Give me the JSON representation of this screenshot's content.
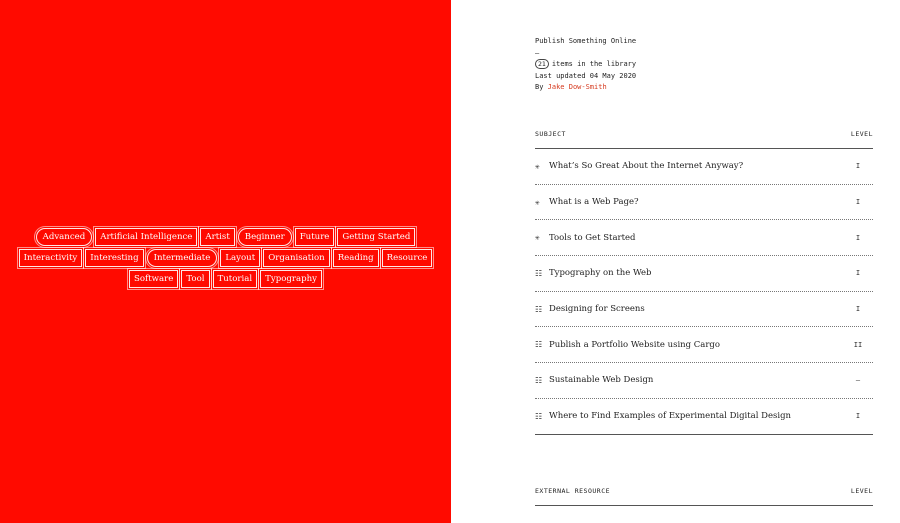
{
  "tags": [
    [
      {
        "label": "Advanced",
        "pill": true
      },
      {
        "label": "Artificial Intelligence",
        "pill": false
      },
      {
        "label": "Artist",
        "pill": false
      },
      {
        "label": "Beginner",
        "pill": true
      },
      {
        "label": "Future",
        "pill": false
      },
      {
        "label": "Getting Started",
        "pill": false
      }
    ],
    [
      {
        "label": "Interactivity",
        "pill": false
      },
      {
        "label": "Interesting",
        "pill": false
      },
      {
        "label": "Intermediate",
        "pill": true
      },
      {
        "label": "Layout",
        "pill": false
      },
      {
        "label": "Organisation",
        "pill": false
      },
      {
        "label": "Reading",
        "pill": false
      },
      {
        "label": "Resource",
        "pill": false
      }
    ],
    [
      {
        "label": "Software",
        "pill": false
      },
      {
        "label": "Tool",
        "pill": false
      },
      {
        "label": "Tutorial",
        "pill": false
      },
      {
        "label": "Typography",
        "pill": false
      }
    ]
  ],
  "meta": {
    "title": "Publish Something Online",
    "dash": "–",
    "count": "21",
    "count_suffix": "items in the library",
    "updated": "Last updated 04 May 2020",
    "by": "By",
    "author": "Jake Dow-Smith"
  },
  "subjects": {
    "header_subject": "SUBJECT",
    "header_level": "LEVEL",
    "rows": [
      {
        "icon": "✳",
        "title": "What’s So Great About the Internet Anyway?",
        "level": "I"
      },
      {
        "icon": "✳",
        "title": "What is a Web Page?",
        "level": "I"
      },
      {
        "icon": "✳",
        "title": "Tools to Get Started",
        "level": "I"
      },
      {
        "icon": "☷",
        "title": "Typography on the Web",
        "level": "I"
      },
      {
        "icon": "☷",
        "title": "Designing for Screens",
        "level": "I"
      },
      {
        "icon": "☷",
        "title": "Publish a Portfolio Website using Cargo",
        "level": "II"
      },
      {
        "icon": "☷",
        "title": "Sustainable Web Design",
        "level": "–"
      },
      {
        "icon": "☷",
        "title": "Where to Find Examples of Experimental Digital Design",
        "level": "I"
      }
    ]
  },
  "external": {
    "header_resource": "EXTERNAL RESOURCE",
    "header_level": "LEVEL"
  }
}
